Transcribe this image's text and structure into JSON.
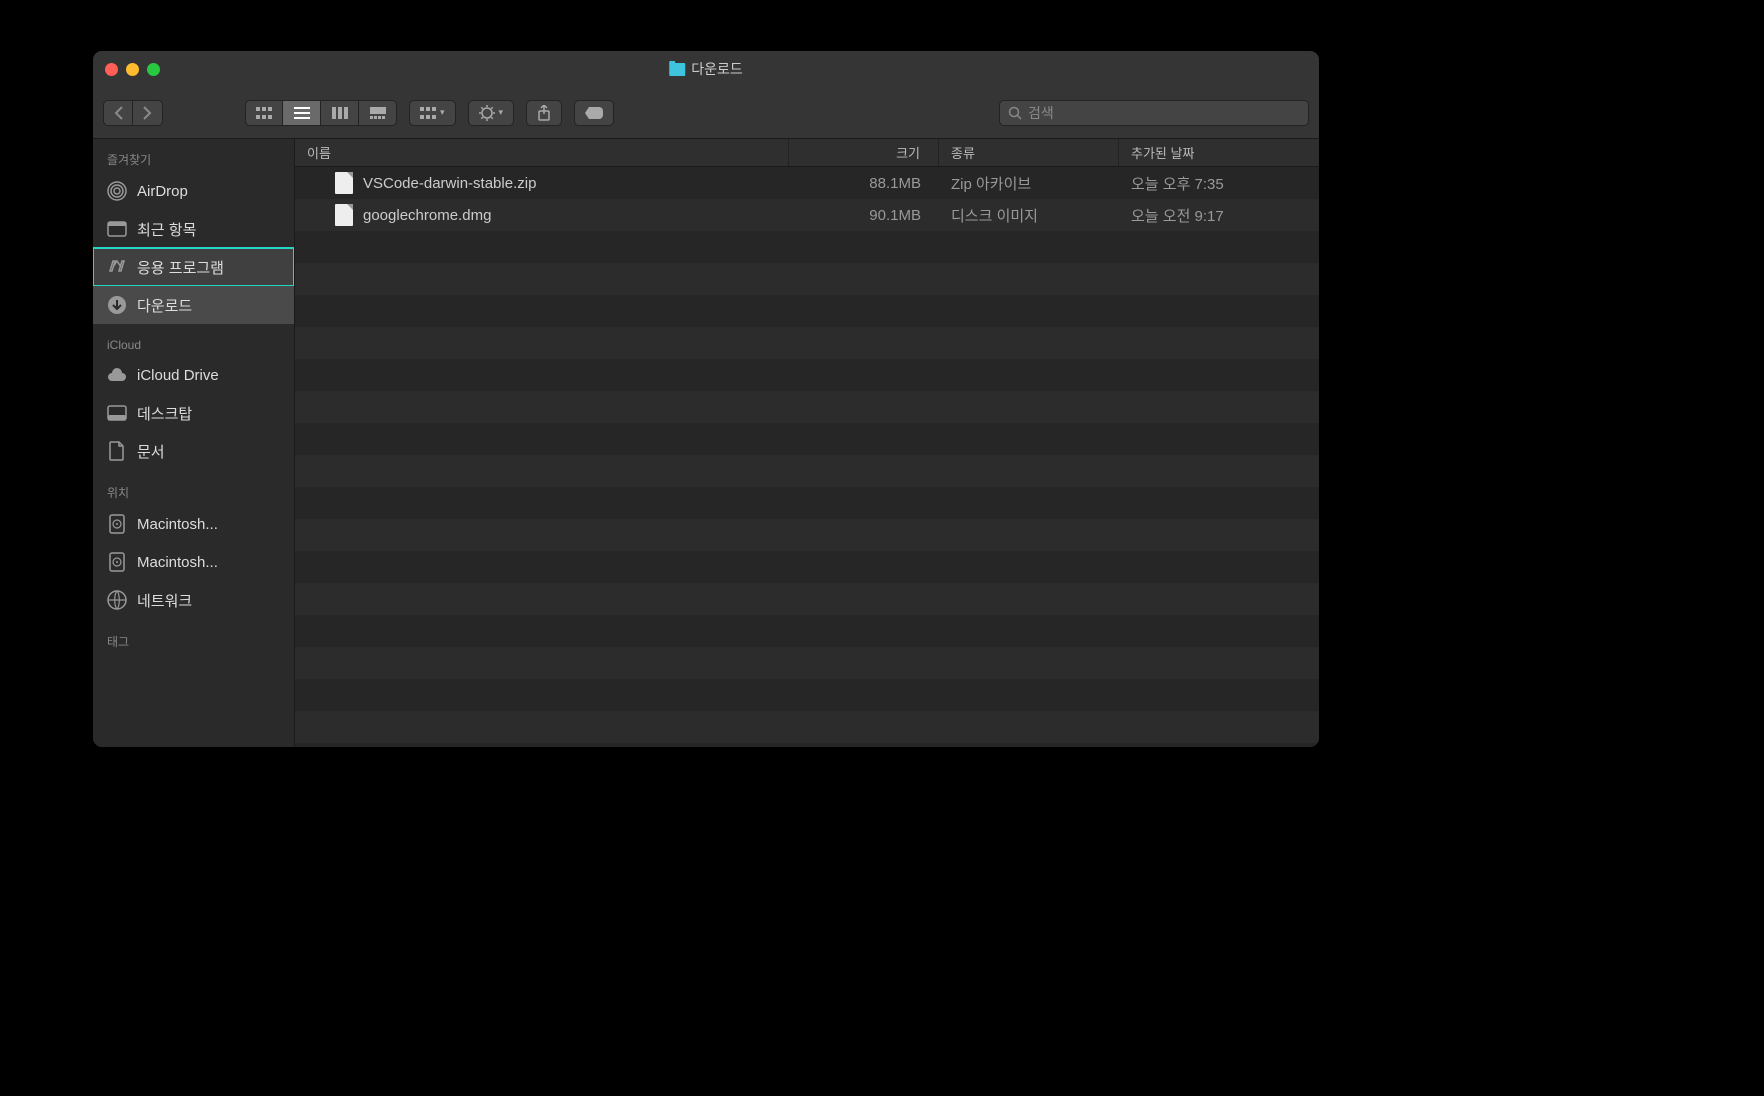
{
  "window": {
    "title": "다운로드"
  },
  "search": {
    "placeholder": "검색"
  },
  "sidebar": {
    "sections": [
      {
        "header": "즐겨찾기",
        "items": [
          {
            "label": "AirDrop"
          },
          {
            "label": "최근 항목"
          },
          {
            "label": "응용 프로그램"
          },
          {
            "label": "다운로드"
          }
        ]
      },
      {
        "header": "iCloud",
        "items": [
          {
            "label": "iCloud Drive"
          },
          {
            "label": "데스크탑"
          },
          {
            "label": "문서"
          }
        ]
      },
      {
        "header": "위치",
        "items": [
          {
            "label": "Macintosh..."
          },
          {
            "label": "Macintosh..."
          },
          {
            "label": "네트워크"
          }
        ]
      },
      {
        "header": "태그",
        "items": []
      }
    ]
  },
  "columns": {
    "name": "이름",
    "size": "크기",
    "kind": "종류",
    "date": "추가된 날짜"
  },
  "files": [
    {
      "name": "VSCode-darwin-stable.zip",
      "size": "88.1MB",
      "kind": "Zip 아카이브",
      "date": "오늘 오후 7:35"
    },
    {
      "name": "googlechrome.dmg",
      "size": "90.1MB",
      "kind": "디스크 이미지",
      "date": "오늘 오전 9:17"
    }
  ]
}
